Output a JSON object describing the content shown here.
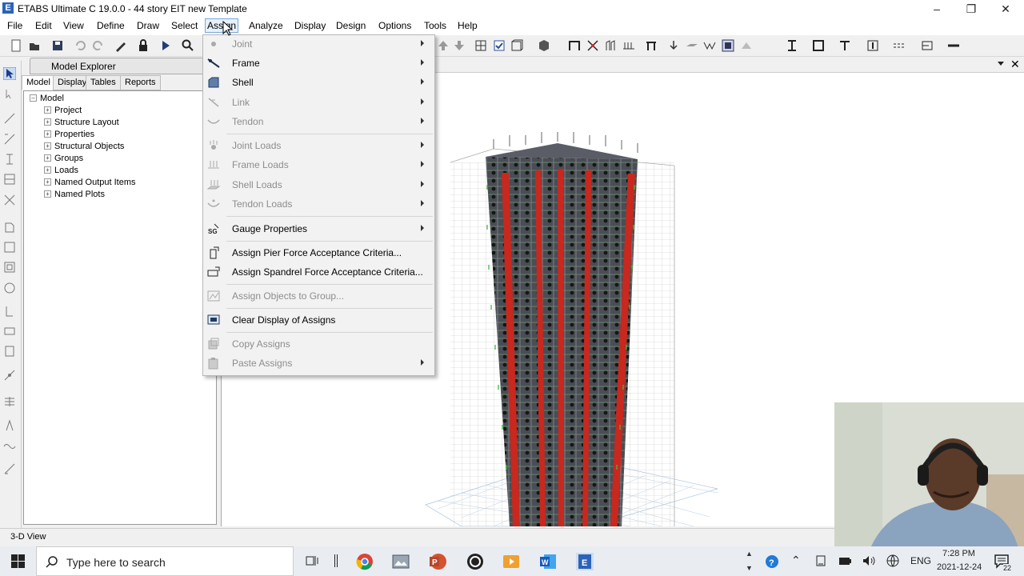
{
  "window": {
    "title": "ETABS Ultimate C 19.0.0 - 44 story EIT new Template",
    "app_icon_letter": "E",
    "controls": [
      "minimize-icon",
      "restore-icon",
      "close-icon"
    ]
  },
  "menubar": {
    "items": [
      "File",
      "Edit",
      "View",
      "Define",
      "Draw",
      "Select",
      "Assign",
      "Analyze",
      "Display",
      "Design",
      "Options",
      "Tools",
      "Help"
    ],
    "active": "Assign"
  },
  "model_explorer": {
    "title": "Model Explorer",
    "tabs": [
      "Model",
      "Display",
      "Tables",
      "Reports"
    ],
    "selected_tab": "Model",
    "root": "Model",
    "nodes": [
      "Project",
      "Structure Layout",
      "Properties",
      "Structural Objects",
      "Groups",
      "Loads",
      "Named Output Items",
      "Named Plots"
    ]
  },
  "assign_menu": {
    "items": [
      {
        "label": "Joint",
        "enabled": false,
        "submenu": true,
        "icon": "joint-icon"
      },
      {
        "label": "Frame",
        "enabled": true,
        "submenu": true,
        "icon": "frame-icon"
      },
      {
        "label": "Shell",
        "enabled": true,
        "submenu": true,
        "icon": "shell-icon"
      },
      {
        "label": "Link",
        "enabled": false,
        "submenu": true,
        "icon": "link-icon"
      },
      {
        "label": "Tendon",
        "enabled": false,
        "submenu": true,
        "icon": "tendon-icon"
      },
      {
        "label": "Joint Loads",
        "enabled": false,
        "submenu": true,
        "icon": "joint-loads-icon"
      },
      {
        "label": "Frame Loads",
        "enabled": false,
        "submenu": true,
        "icon": "frame-loads-icon"
      },
      {
        "label": "Shell Loads",
        "enabled": false,
        "submenu": true,
        "icon": "shell-loads-icon"
      },
      {
        "label": "Tendon Loads",
        "enabled": false,
        "submenu": true,
        "icon": "tendon-loads-icon"
      },
      {
        "label": "Gauge Properties",
        "enabled": true,
        "submenu": true,
        "icon": "gauge-icon"
      },
      {
        "label": "Assign Pier Force Acceptance Criteria...",
        "enabled": true,
        "submenu": false,
        "icon": "pier-force-icon"
      },
      {
        "label": "Assign Spandrel Force Acceptance Criteria...",
        "enabled": true,
        "submenu": false,
        "icon": "spandrel-force-icon"
      },
      {
        "label": "Assign Objects to Group...",
        "enabled": false,
        "submenu": false,
        "icon": "group-icon"
      },
      {
        "label": "Clear Display of Assigns",
        "enabled": true,
        "submenu": false,
        "icon": "clear-display-icon"
      },
      {
        "label": "Copy Assigns",
        "enabled": false,
        "submenu": false,
        "icon": "copy-assigns-icon"
      },
      {
        "label": "Paste Assigns",
        "enabled": false,
        "submenu": true,
        "icon": "paste-assigns-icon"
      }
    ]
  },
  "status": {
    "text": "3-D View"
  },
  "taskbar": {
    "search_placeholder": "Type here to search",
    "language": "ENG",
    "time": "7:28 PM",
    "date": "2021-12-24",
    "notifications": "22"
  },
  "colors": {
    "menu_bg": "#f2f2f2",
    "disabled_text": "#8d8d8d",
    "active_menu_border": "#7aa7d9",
    "structure_red": "#c8281e",
    "structure_dark": "#2a2a2a",
    "taskbar_bg": "#e9edf2"
  }
}
